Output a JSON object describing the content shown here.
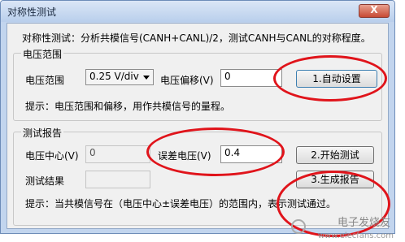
{
  "window": {
    "title": "对称性测试",
    "close": "X"
  },
  "description": "对称性测试：分析共模信号(CANH+CANL)/2，测试CANH与CANL的对称程度。",
  "voltage_group": {
    "legend": "电压范围",
    "range_label": "电压范围",
    "range_value": "0.25 V/div",
    "offset_label": "电压偏移(V)",
    "offset_value": "0",
    "auto_button": "1.自动设置",
    "hint": "提示：电压范围和偏移，用作共模信号的量程。"
  },
  "report_group": {
    "legend": "测试报告",
    "center_label": "电压中心(V)",
    "center_value": "0",
    "error_label": "误差电压(V)",
    "error_value": "0.4",
    "start_button": "2.开始测试",
    "result_label": "测试结果",
    "result_value": "",
    "report_button": "3.生成报告",
    "hint": "提示：当共模信号在（电压中心±误差电压）的范围内，表示测试通过。"
  },
  "watermark": {
    "brand": "电子发烧友",
    "url": "www.elecfans.com"
  },
  "colors": {
    "annotation": "#e0141b"
  }
}
